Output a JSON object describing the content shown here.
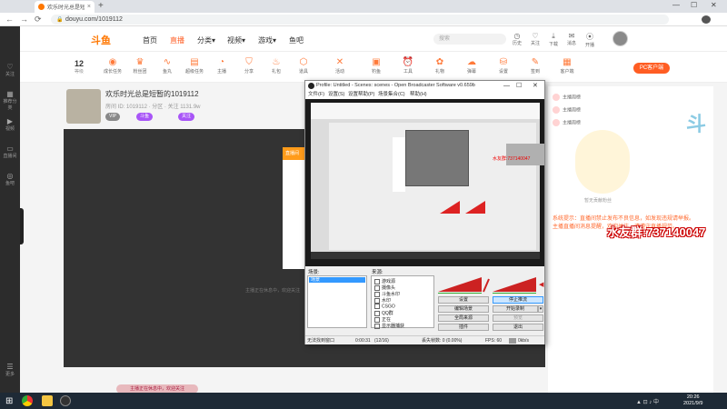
{
  "browser": {
    "tab_title": "欢乐时光总是短暂的1019112",
    "url": "douyu.com/1019112",
    "new_tab": "+",
    "back": "←",
    "forward": "→",
    "reload": "⟳",
    "minimize": "—",
    "maximize": "☐",
    "close": "✕",
    "tab_close": "×"
  },
  "watermark": "斗鱼",
  "site": {
    "logo": "斗鱼",
    "nav": [
      "首页",
      "直播",
      "分类▾",
      "视频▾",
      "游戏▾",
      "鱼吧"
    ],
    "search_placeholder": "搜索",
    "top_icons": [
      "历史",
      "关注",
      "下载",
      "消息",
      "开播"
    ],
    "left_sidebar": [
      "关注",
      "推荐分类",
      "视频",
      "直播间",
      "鱼吧",
      "更多"
    ],
    "level": "12",
    "level_label": "等级",
    "icon_row": [
      "成长任务",
      "粉丝团",
      "鱼丸",
      "超级任务",
      "主播",
      "分享",
      "礼包",
      "道具",
      "活动",
      "钓鱼",
      "工具",
      "礼物",
      "弹幕",
      "设置",
      "签到",
      "客户端"
    ],
    "pc_button": "PC客户端",
    "room_title": "欢乐时光总是短暂的1019112",
    "room_sub": "房间 ID: 1019112 · 分区 · 关注 1131.9w",
    "room_tags": [
      "VIP",
      "斗鱼",
      "关注"
    ],
    "player_card_head": "直播间",
    "player_tip": "主播正在休息中，欢迎关注",
    "danmu_text": "主播正在休息中，欢迎关注",
    "rank_items": [
      "主播周榜",
      "主播周榜",
      "主播周榜"
    ],
    "mascot_caption": "暂无贡献粉丝",
    "notice": "系统提示：直播间禁止发布不良信息，如发现违规请举报。主播直播间消息提醒，欢迎关注，请遵守直播规范。",
    "qq_group": "水友群:737140047",
    "deco": "斗"
  },
  "obs": {
    "title": "Profile: Untitled - Scenes: scenes - Open Broadcaster Software v0.659b",
    "minimize": "—",
    "maximize": "☐",
    "close": "✕",
    "menu": [
      "文件(F)",
      "设置(S)",
      "设置帮助(P)",
      "场景集合(C)",
      "帮助(H)"
    ],
    "scenes_label": "场景:",
    "sources_label": "来源:",
    "scenes": [
      "场景"
    ],
    "sources": [
      "游戏源",
      "摄像头",
      "斗鱼水印",
      "水印",
      "CSGO",
      "QQ群",
      "正在",
      "显示器捕获"
    ],
    "buttons": {
      "settings": "设置",
      "stop_stream": "停止推流",
      "edit_scene": "编辑场景",
      "start_record": "开始录制",
      "global_sources": "全局来源",
      "preview": "预览",
      "plugins": "插件",
      "exit": "退出"
    },
    "status": {
      "scene": "无法找到窗口",
      "time": "0:00:31",
      "time_extra": "(12/16)",
      "dropped": "丢失帧数: 0 (0.00%)",
      "fps": "FPS: 60",
      "bitrate": "0kb/s"
    },
    "preview_red_text": "水友群:737140047"
  },
  "taskbar": {
    "time": "20:26",
    "date": "2021/9/9",
    "start": "⊞"
  },
  "colors": {
    "brand": "#ff7700",
    "accent": "#ff5d23",
    "obs_highlight": "#3399ff"
  }
}
